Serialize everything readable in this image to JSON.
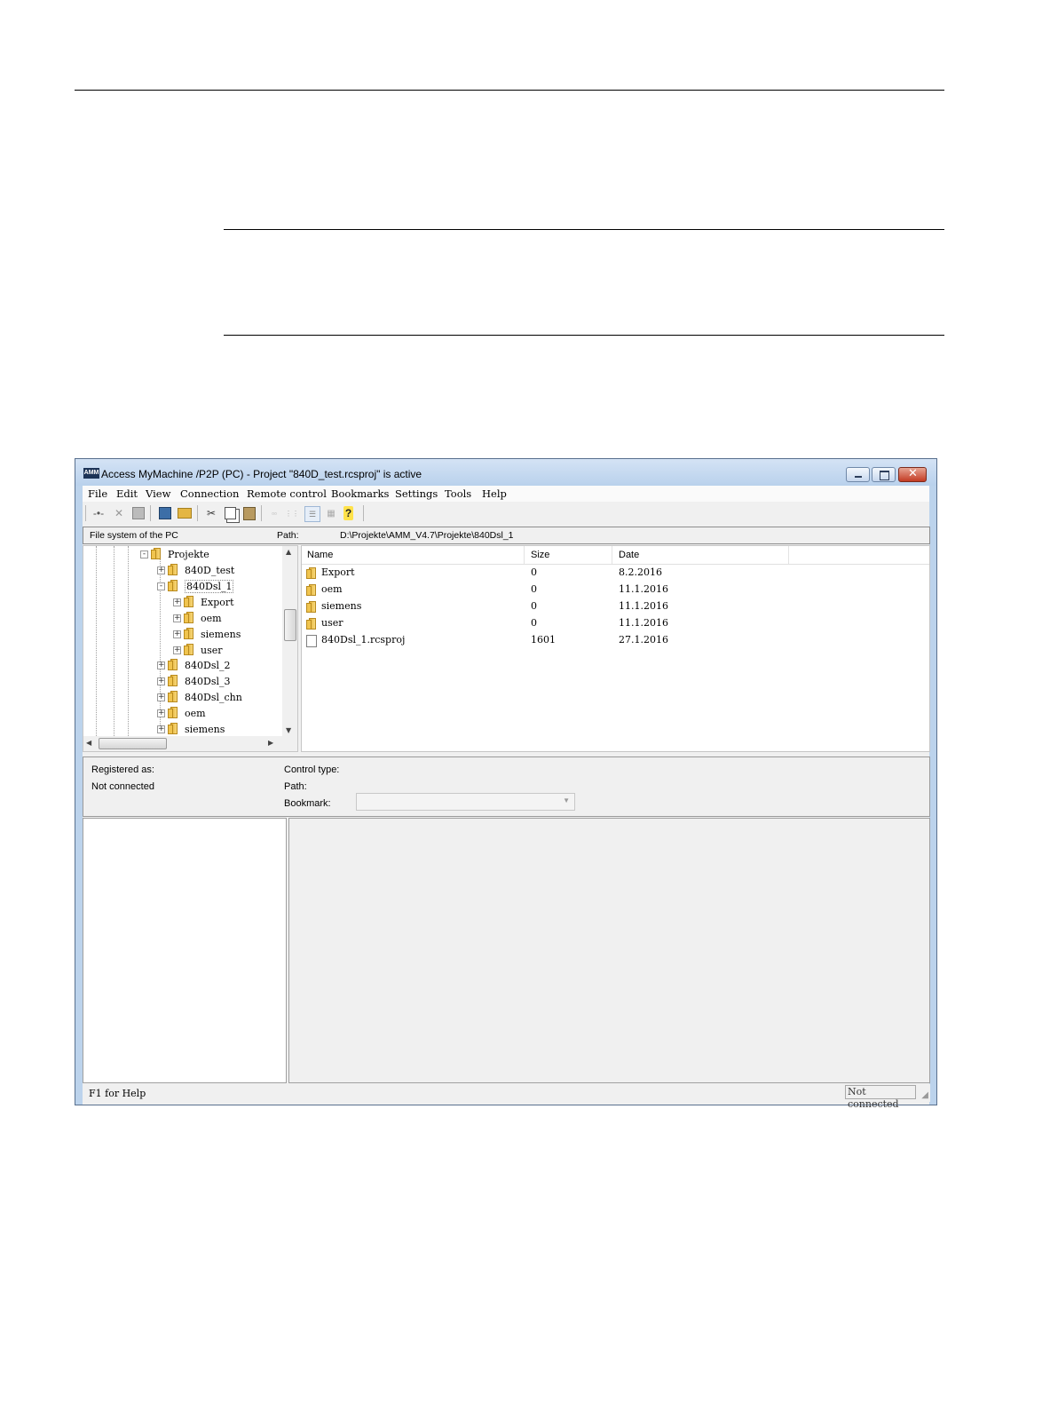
{
  "window": {
    "title": "Access MyMachine /P2P (PC) - Project \"840D_test.rcsproj\" is active",
    "app_icon_text": "AMM"
  },
  "menu": [
    "File",
    "Edit",
    "View",
    "Connection",
    "Remote control",
    "Bookmarks",
    "Settings",
    "Tools",
    "Help"
  ],
  "toolbar": {
    "icons": [
      "connect-icon",
      "disconnect-icon",
      "save-icon",
      "properties-icon",
      "open-folder-icon",
      "cut-icon",
      "copy-icon",
      "paste-icon",
      "large-icons-icon",
      "small-icons-icon",
      "list-view-icon",
      "details-view-icon",
      "help-icon"
    ]
  },
  "pathbar": {
    "left_label": "File system of the PC",
    "path_label": "Path:",
    "path_value": "D:\\Projekte\\AMM_V4.7\\Projekte\\840Dsl_1"
  },
  "tree": [
    {
      "label": "Projekte",
      "expander": "-"
    },
    {
      "label": "840D_test",
      "expander": "+"
    },
    {
      "label": "840Dsl_1",
      "expander": "-"
    },
    {
      "label": "Export",
      "expander": "+"
    },
    {
      "label": "oem",
      "expander": "+"
    },
    {
      "label": "siemens",
      "expander": "+"
    },
    {
      "label": "user",
      "expander": "+"
    },
    {
      "label": "840Dsl_2",
      "expander": "+"
    },
    {
      "label": "840Dsl_3",
      "expander": "+"
    },
    {
      "label": "840Dsl_chn",
      "expander": "+"
    },
    {
      "label": "oem",
      "expander": "+"
    },
    {
      "label": "siemens",
      "expander": "+"
    }
  ],
  "list": {
    "columns": [
      "Name",
      "Size",
      "Date"
    ],
    "rows": [
      {
        "name": "Export",
        "size": "0",
        "date": "8.2.2016",
        "type": "folder"
      },
      {
        "name": "oem",
        "size": "0",
        "date": "11.1.2016",
        "type": "folder"
      },
      {
        "name": "siemens",
        "size": "0",
        "date": "11.1.2016",
        "type": "folder"
      },
      {
        "name": "user",
        "size": "0",
        "date": "11.1.2016",
        "type": "folder"
      },
      {
        "name": "840Dsl_1.rcsproj",
        "size": "1601",
        "date": "27.1.2016",
        "type": "file"
      }
    ]
  },
  "info": {
    "registered_label": "Registered as:",
    "registered_value": "Not connected",
    "control_type_label": "Control type:",
    "path_label": "Path:",
    "bookmark_label": "Bookmark:"
  },
  "statusbar": {
    "help": "F1 for Help",
    "connection": "Not connected"
  }
}
